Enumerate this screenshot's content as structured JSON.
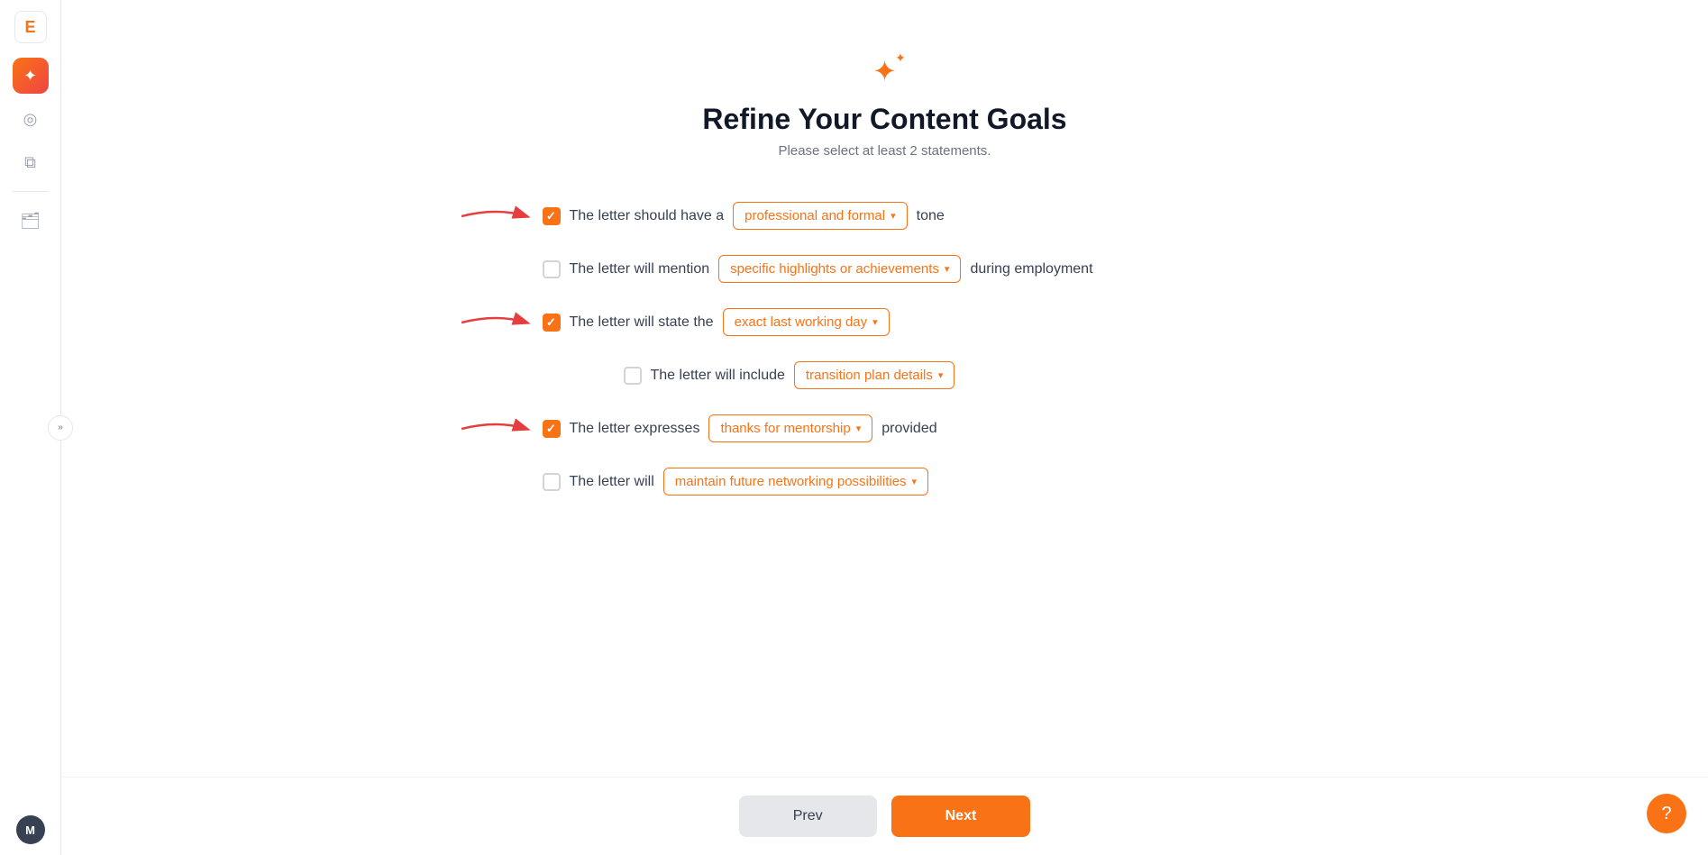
{
  "sidebar": {
    "logo_text": "E",
    "items": [
      {
        "id": "ai",
        "icon": "✦",
        "label": "AI",
        "active": true
      },
      {
        "id": "search",
        "icon": "◎",
        "label": "Search",
        "active": false
      },
      {
        "id": "docs",
        "icon": "⧉",
        "label": "Docs",
        "active": false
      }
    ],
    "folder_icon": "🗂",
    "collapse_label": "»",
    "avatar_label": "M"
  },
  "page": {
    "icon": "✦",
    "title": "Refine Your Content Goals",
    "subtitle": "Please select at least 2 statements."
  },
  "rows": [
    {
      "id": "row1",
      "checked": true,
      "prefix": "The letter should have a",
      "dropdown_value": "professional and formal",
      "suffix": "tone",
      "has_arrow": true
    },
    {
      "id": "row2",
      "checked": false,
      "prefix": "The letter will mention",
      "dropdown_value": "specific highlights or achievements",
      "suffix": "during employment",
      "has_arrow": false
    },
    {
      "id": "row3",
      "checked": true,
      "prefix": "The letter will state the",
      "dropdown_value": "exact last working day",
      "suffix": "",
      "has_arrow": true
    },
    {
      "id": "row4",
      "checked": false,
      "prefix": "The letter will include",
      "dropdown_value": "transition plan details",
      "suffix": "",
      "has_arrow": false
    },
    {
      "id": "row5",
      "checked": true,
      "prefix": "The letter expresses",
      "dropdown_value": "thanks for mentorship",
      "suffix": "provided",
      "has_arrow": true
    },
    {
      "id": "row6",
      "checked": false,
      "prefix": "The letter will",
      "dropdown_value": "maintain future networking possibilities",
      "suffix": "",
      "has_arrow": false
    }
  ],
  "buttons": {
    "prev_label": "Prev",
    "next_label": "Next"
  },
  "support_icon": "?",
  "colors": {
    "orange": "#f97316",
    "red": "#ef4444"
  }
}
